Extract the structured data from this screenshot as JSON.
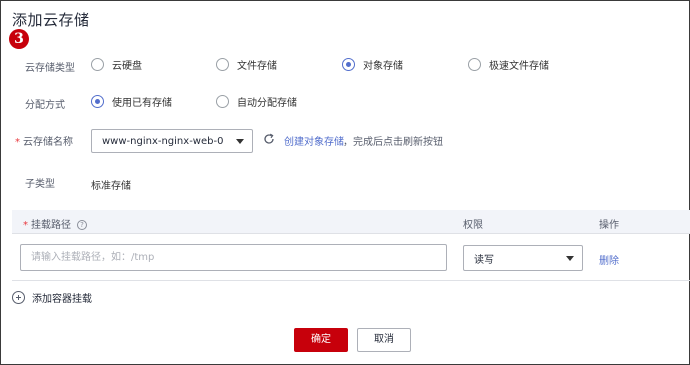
{
  "dialog": {
    "title": "添加云存储",
    "step_badge": "3"
  },
  "storage_type": {
    "label": "云存储类型",
    "options": [
      {
        "label": "云硬盘",
        "selected": false
      },
      {
        "label": "文件存储",
        "selected": false
      },
      {
        "label": "对象存储",
        "selected": true
      },
      {
        "label": "极速文件存储",
        "selected": false
      }
    ]
  },
  "allocation": {
    "label": "分配方式",
    "options": [
      {
        "label": "使用已有存储",
        "selected": true
      },
      {
        "label": "自动分配存储",
        "selected": false
      }
    ]
  },
  "storage_name": {
    "label": "云存储名称",
    "value": "www-nginx-nginx-web-0",
    "create_link": "创建对象存储",
    "hint": "，完成后点击刷新按钮"
  },
  "subtype": {
    "label": "子类型",
    "value": "标准存储"
  },
  "mount_table": {
    "headers": {
      "path": "挂载路径",
      "permission": "权限",
      "action": "操作"
    },
    "row": {
      "path_placeholder": "请输入挂载路径，如：/tmp",
      "permission_value": "读写",
      "delete_label": "删除"
    },
    "add_label": "添加容器挂载"
  },
  "buttons": {
    "confirm": "确定",
    "cancel": "取消"
  },
  "colors": {
    "brand": "#c7000b",
    "accent": "#526ecc",
    "required": "#e8383d"
  }
}
